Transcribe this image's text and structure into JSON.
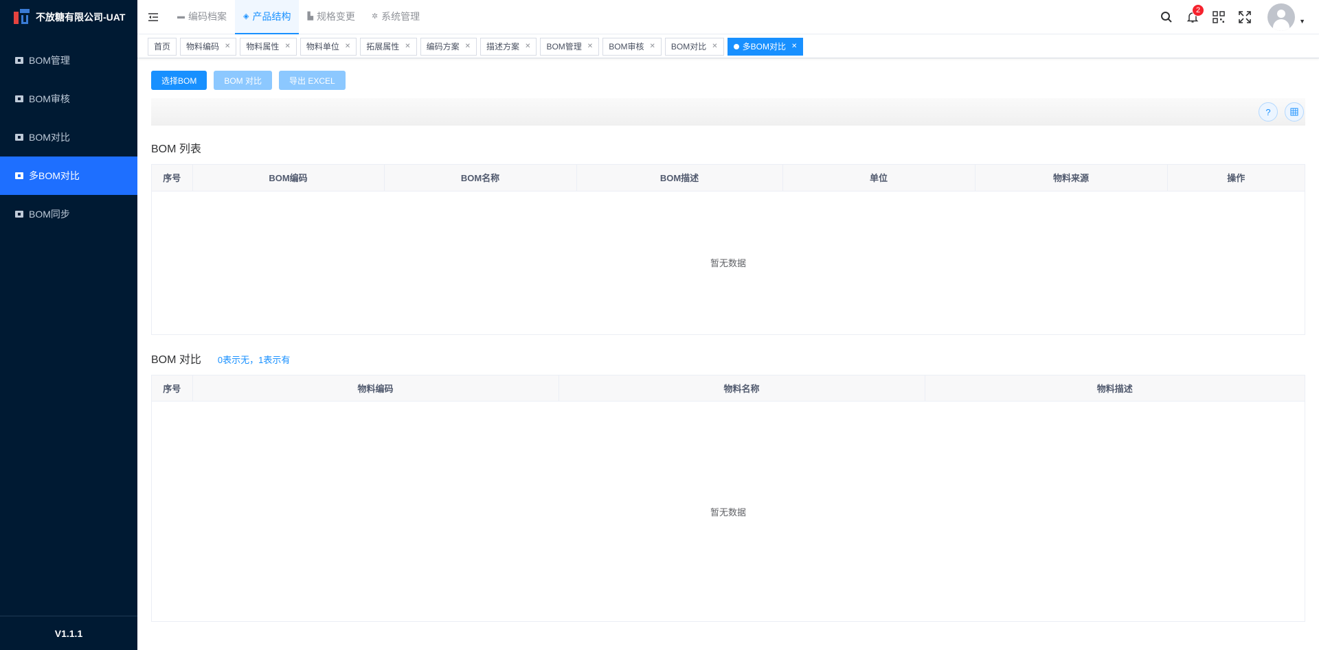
{
  "app": {
    "title": "不放糖有限公司-UAT",
    "version": "V1.1.1"
  },
  "sidebar": {
    "items": [
      {
        "label": "BOM管理"
      },
      {
        "label": "BOM审核"
      },
      {
        "label": "BOM对比"
      },
      {
        "label": "多BOM对比",
        "active": true
      },
      {
        "label": "BOM同步"
      }
    ]
  },
  "topnav": {
    "items": [
      {
        "label": "编码档案",
        "icon": "folder-icon"
      },
      {
        "label": "产品结构",
        "icon": "layers-icon",
        "active": true
      },
      {
        "label": "规格变更",
        "icon": "chart-icon"
      },
      {
        "label": "系统管理",
        "icon": "gear-icon"
      }
    ]
  },
  "header": {
    "notification_count": "2"
  },
  "tags": [
    {
      "label": "首页"
    },
    {
      "label": "物料编码"
    },
    {
      "label": "物料属性"
    },
    {
      "label": "物料单位"
    },
    {
      "label": "拓展属性"
    },
    {
      "label": "编码方案"
    },
    {
      "label": "描述方案"
    },
    {
      "label": "BOM管理"
    },
    {
      "label": "BOM审核"
    },
    {
      "label": "BOM对比"
    },
    {
      "label": "多BOM对比",
      "active": true
    }
  ],
  "toolbar": {
    "select_bom": "选择BOM",
    "compare_bom": "BOM 对比",
    "export_excel": "导出 EXCEL",
    "help_icon_text": "?"
  },
  "bom_list": {
    "title": "BOM 列表",
    "columns": [
      "序号",
      "BOM编码",
      "BOM名称",
      "BOM描述",
      "单位",
      "物料来源",
      "操作"
    ],
    "empty_text": "暂无数据"
  },
  "bom_compare": {
    "title": "BOM 对比",
    "hint": "0表示无，1表示有",
    "columns": [
      "序号",
      "物料编码",
      "物料名称",
      "物料描述"
    ],
    "empty_text": "暂无数据"
  },
  "colors": {
    "sidebar_bg": "#001a33",
    "accent": "#1890ff",
    "menu_active": "#1e6fff",
    "badge": "#f5222d"
  }
}
